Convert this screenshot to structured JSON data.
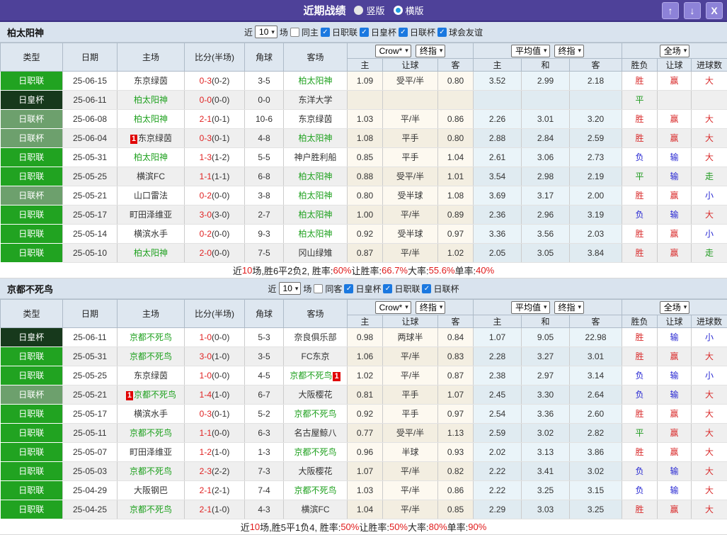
{
  "titlebar": {
    "title": "近期战绩",
    "radios": [
      {
        "label": "竖版",
        "selected": false
      },
      {
        "label": "横版",
        "selected": true
      }
    ],
    "buttons": {
      "up": "↑",
      "down": "↓",
      "close": "X"
    }
  },
  "table_header": {
    "main": [
      "类型",
      "日期",
      "主场",
      "比分(半场)",
      "角球",
      "客场"
    ],
    "sub": [
      "主",
      "让球",
      "客",
      "主",
      "和",
      "客",
      "胜负",
      "让球",
      "进球数"
    ],
    "selects": {
      "bookmaker": "Crow*",
      "bookmaker_final": "终指",
      "average": "平均值",
      "average_final": "终指",
      "scope": "全场"
    }
  },
  "sections": [
    {
      "team": "柏太阳神",
      "filter": {
        "prefix": "近",
        "count": "10",
        "suffix": "场",
        "same_label": "同主",
        "same_checked": false,
        "leagues": [
          "日职联",
          "日皇杯",
          "日联杯",
          "球会友谊"
        ]
      },
      "rows": [
        {
          "league": "日职联",
          "league_cls": "j1",
          "date": "25-06-15",
          "home": {
            "name": "东京绿茵",
            "focal": false,
            "badge": null
          },
          "score": "0-3",
          "half": "(0-2)",
          "corners": "3-5",
          "away": {
            "name": "柏太阳神",
            "focal": true,
            "badge": null
          },
          "crow_home": "1.09",
          "handicap": "受平/半",
          "crow_away": "0.80",
          "avg_home": "3.52",
          "avg_draw": "2.99",
          "avg_away": "2.18",
          "result": {
            "text": "胜",
            "cls": "win"
          },
          "handicap_result": {
            "text": "赢",
            "cls": "win"
          },
          "goals": {
            "text": "大",
            "cls": "win"
          }
        },
        {
          "league": "日皇杯",
          "league_cls": "cup",
          "date": "25-06-11",
          "home": {
            "name": "柏太阳神",
            "focal": true,
            "badge": null
          },
          "score": "0-0",
          "half": "(0-0)",
          "corners": "0-0",
          "away": {
            "name": "东洋大学",
            "focal": false,
            "badge": null
          },
          "crow_home": "",
          "handicap": "",
          "crow_away": "",
          "avg_home": "",
          "avg_draw": "",
          "avg_away": "",
          "result": {
            "text": "平",
            "cls": "draw"
          },
          "handicap_result": {
            "text": "",
            "cls": ""
          },
          "goals": {
            "text": "",
            "cls": ""
          }
        },
        {
          "league": "日联杯",
          "league_cls": "lcup",
          "date": "25-06-08",
          "home": {
            "name": "柏太阳神",
            "focal": true,
            "badge": null
          },
          "score": "2-1",
          "half": "(0-1)",
          "corners": "10-6",
          "away": {
            "name": "东京绿茵",
            "focal": false,
            "badge": null
          },
          "crow_home": "1.03",
          "handicap": "平/半",
          "crow_away": "0.86",
          "avg_home": "2.26",
          "avg_draw": "3.01",
          "avg_away": "3.20",
          "result": {
            "text": "胜",
            "cls": "win"
          },
          "handicap_result": {
            "text": "赢",
            "cls": "win"
          },
          "goals": {
            "text": "大",
            "cls": "win"
          }
        },
        {
          "league": "日联杯",
          "league_cls": "lcup",
          "date": "25-06-04",
          "home": {
            "name": "东京绿茵",
            "focal": false,
            "badge": {
              "text": "1",
              "pos": "before"
            }
          },
          "score": "0-3",
          "half": "(0-1)",
          "corners": "4-8",
          "away": {
            "name": "柏太阳神",
            "focal": true,
            "badge": null
          },
          "crow_home": "1.08",
          "handicap": "平手",
          "crow_away": "0.80",
          "avg_home": "2.88",
          "avg_draw": "2.84",
          "avg_away": "2.59",
          "result": {
            "text": "胜",
            "cls": "win"
          },
          "handicap_result": {
            "text": "赢",
            "cls": "win"
          },
          "goals": {
            "text": "大",
            "cls": "win"
          }
        },
        {
          "league": "日职联",
          "league_cls": "j1",
          "date": "25-05-31",
          "home": {
            "name": "柏太阳神",
            "focal": true,
            "badge": null
          },
          "score": "1-3",
          "half": "(1-2)",
          "corners": "5-5",
          "away": {
            "name": "神户胜利船",
            "focal": false,
            "badge": null
          },
          "crow_home": "0.85",
          "handicap": "平手",
          "crow_away": "1.04",
          "avg_home": "2.61",
          "avg_draw": "3.06",
          "avg_away": "2.73",
          "result": {
            "text": "负",
            "cls": "lose"
          },
          "handicap_result": {
            "text": "输",
            "cls": "lose"
          },
          "goals": {
            "text": "大",
            "cls": "win"
          }
        },
        {
          "league": "日职联",
          "league_cls": "j1",
          "date": "25-05-25",
          "home": {
            "name": "横滨FC",
            "focal": false,
            "badge": null
          },
          "score": "1-1",
          "half": "(1-1)",
          "corners": "6-8",
          "away": {
            "name": "柏太阳神",
            "focal": true,
            "badge": null
          },
          "crow_home": "0.88",
          "handicap": "受平/半",
          "crow_away": "1.01",
          "avg_home": "3.54",
          "avg_draw": "2.98",
          "avg_away": "2.19",
          "result": {
            "text": "平",
            "cls": "draw"
          },
          "handicap_result": {
            "text": "输",
            "cls": "lose"
          },
          "goals": {
            "text": "走",
            "cls": "draw"
          }
        },
        {
          "league": "日联杯",
          "league_cls": "lcup",
          "date": "25-05-21",
          "home": {
            "name": "山口雷法",
            "focal": false,
            "badge": null
          },
          "score": "0-2",
          "half": "(0-0)",
          "corners": "3-8",
          "away": {
            "name": "柏太阳神",
            "focal": true,
            "badge": null
          },
          "crow_home": "0.80",
          "handicap": "受半球",
          "crow_away": "1.08",
          "avg_home": "3.69",
          "avg_draw": "3.17",
          "avg_away": "2.00",
          "result": {
            "text": "胜",
            "cls": "win"
          },
          "handicap_result": {
            "text": "赢",
            "cls": "win"
          },
          "goals": {
            "text": "小",
            "cls": "lose"
          }
        },
        {
          "league": "日职联",
          "league_cls": "j1",
          "date": "25-05-17",
          "home": {
            "name": "町田泽维亚",
            "focal": false,
            "badge": null
          },
          "score": "3-0",
          "half": "(3-0)",
          "corners": "2-7",
          "away": {
            "name": "柏太阳神",
            "focal": true,
            "badge": null
          },
          "crow_home": "1.00",
          "handicap": "平/半",
          "crow_away": "0.89",
          "avg_home": "2.36",
          "avg_draw": "2.96",
          "avg_away": "3.19",
          "result": {
            "text": "负",
            "cls": "lose"
          },
          "handicap_result": {
            "text": "输",
            "cls": "lose"
          },
          "goals": {
            "text": "大",
            "cls": "win"
          }
        },
        {
          "league": "日职联",
          "league_cls": "j1",
          "date": "25-05-14",
          "home": {
            "name": "横滨水手",
            "focal": false,
            "badge": null
          },
          "score": "0-2",
          "half": "(0-0)",
          "corners": "9-3",
          "away": {
            "name": "柏太阳神",
            "focal": true,
            "badge": null
          },
          "crow_home": "0.92",
          "handicap": "受半球",
          "crow_away": "0.97",
          "avg_home": "3.36",
          "avg_draw": "3.56",
          "avg_away": "2.03",
          "result": {
            "text": "胜",
            "cls": "win"
          },
          "handicap_result": {
            "text": "赢",
            "cls": "win"
          },
          "goals": {
            "text": "小",
            "cls": "lose"
          }
        },
        {
          "league": "日职联",
          "league_cls": "j1",
          "date": "25-05-10",
          "home": {
            "name": "柏太阳神",
            "focal": true,
            "badge": null
          },
          "score": "2-0",
          "half": "(0-0)",
          "corners": "7-5",
          "away": {
            "name": "冈山绿雉",
            "focal": false,
            "badge": null
          },
          "crow_home": "0.87",
          "handicap": "平/半",
          "crow_away": "1.02",
          "avg_home": "2.05",
          "avg_draw": "3.05",
          "avg_away": "3.84",
          "result": {
            "text": "胜",
            "cls": "win"
          },
          "handicap_result": {
            "text": "赢",
            "cls": "win"
          },
          "goals": {
            "text": "走",
            "cls": "draw"
          }
        }
      ],
      "summary": [
        {
          "text": "近"
        },
        {
          "text": "10",
          "red": true
        },
        {
          "text": "场,胜6平2负2, 胜率:"
        },
        {
          "text": "60%",
          "red": true
        },
        {
          "text": " 让胜率:"
        },
        {
          "text": "66.7%",
          "red": true
        },
        {
          "text": " 大率:"
        },
        {
          "text": "55.6%",
          "red": true
        },
        {
          "text": " 单率:"
        },
        {
          "text": "40%",
          "red": true
        }
      ]
    },
    {
      "team": "京都不死鸟",
      "filter": {
        "prefix": "近",
        "count": "10",
        "suffix": "场",
        "same_label": "同客",
        "same_checked": false,
        "leagues": [
          "日皇杯",
          "日职联",
          "日联杯"
        ]
      },
      "rows": [
        {
          "league": "日皇杯",
          "league_cls": "cup",
          "date": "25-06-11",
          "home": {
            "name": "京都不死鸟",
            "focal": true,
            "badge": null
          },
          "score": "1-0",
          "half": "(0-0)",
          "corners": "5-3",
          "away": {
            "name": "奈良俱乐部",
            "focal": false,
            "badge": null
          },
          "crow_home": "0.98",
          "handicap": "两球半",
          "crow_away": "0.84",
          "avg_home": "1.07",
          "avg_draw": "9.05",
          "avg_away": "22.98",
          "result": {
            "text": "胜",
            "cls": "win"
          },
          "handicap_result": {
            "text": "输",
            "cls": "lose"
          },
          "goals": {
            "text": "小",
            "cls": "lose"
          }
        },
        {
          "league": "日职联",
          "league_cls": "j1",
          "date": "25-05-31",
          "home": {
            "name": "京都不死鸟",
            "focal": true,
            "badge": null
          },
          "score": "3-0",
          "half": "(1-0)",
          "corners": "3-5",
          "away": {
            "name": "FC东京",
            "focal": false,
            "badge": null
          },
          "crow_home": "1.06",
          "handicap": "平/半",
          "crow_away": "0.83",
          "avg_home": "2.28",
          "avg_draw": "3.27",
          "avg_away": "3.01",
          "result": {
            "text": "胜",
            "cls": "win"
          },
          "handicap_result": {
            "text": "赢",
            "cls": "win"
          },
          "goals": {
            "text": "大",
            "cls": "win"
          }
        },
        {
          "league": "日职联",
          "league_cls": "j1",
          "date": "25-05-25",
          "home": {
            "name": "东京绿茵",
            "focal": false,
            "badge": null
          },
          "score": "1-0",
          "half": "(0-0)",
          "corners": "4-5",
          "away": {
            "name": "京都不死鸟",
            "focal": true,
            "badge": {
              "text": "1",
              "pos": "after"
            }
          },
          "crow_home": "1.02",
          "handicap": "平/半",
          "crow_away": "0.87",
          "avg_home": "2.38",
          "avg_draw": "2.97",
          "avg_away": "3.14",
          "result": {
            "text": "负",
            "cls": "lose"
          },
          "handicap_result": {
            "text": "输",
            "cls": "lose"
          },
          "goals": {
            "text": "小",
            "cls": "lose"
          }
        },
        {
          "league": "日联杯",
          "league_cls": "lcup",
          "date": "25-05-21",
          "home": {
            "name": "京都不死鸟",
            "focal": true,
            "badge": {
              "text": "1",
              "pos": "before"
            }
          },
          "score": "1-4",
          "half": "(1-0)",
          "corners": "6-7",
          "away": {
            "name": "大阪樱花",
            "focal": false,
            "badge": null
          },
          "crow_home": "0.81",
          "handicap": "平手",
          "crow_away": "1.07",
          "avg_home": "2.45",
          "avg_draw": "3.30",
          "avg_away": "2.64",
          "result": {
            "text": "负",
            "cls": "lose"
          },
          "handicap_result": {
            "text": "输",
            "cls": "lose"
          },
          "goals": {
            "text": "大",
            "cls": "win"
          }
        },
        {
          "league": "日职联",
          "league_cls": "j1",
          "date": "25-05-17",
          "home": {
            "name": "横滨水手",
            "focal": false,
            "badge": null
          },
          "score": "0-3",
          "half": "(0-1)",
          "corners": "5-2",
          "away": {
            "name": "京都不死鸟",
            "focal": true,
            "badge": null
          },
          "crow_home": "0.92",
          "handicap": "平手",
          "crow_away": "0.97",
          "avg_home": "2.54",
          "avg_draw": "3.36",
          "avg_away": "2.60",
          "result": {
            "text": "胜",
            "cls": "win"
          },
          "handicap_result": {
            "text": "赢",
            "cls": "win"
          },
          "goals": {
            "text": "大",
            "cls": "win"
          }
        },
        {
          "league": "日职联",
          "league_cls": "j1",
          "date": "25-05-11",
          "home": {
            "name": "京都不死鸟",
            "focal": true,
            "badge": null
          },
          "score": "1-1",
          "half": "(0-0)",
          "corners": "6-3",
          "away": {
            "name": "名古屋鲸八",
            "focal": false,
            "badge": null
          },
          "crow_home": "0.77",
          "handicap": "受平/半",
          "crow_away": "1.13",
          "avg_home": "2.59",
          "avg_draw": "3.02",
          "avg_away": "2.82",
          "result": {
            "text": "平",
            "cls": "draw"
          },
          "handicap_result": {
            "text": "赢",
            "cls": "win"
          },
          "goals": {
            "text": "大",
            "cls": "win"
          }
        },
        {
          "league": "日职联",
          "league_cls": "j1",
          "date": "25-05-07",
          "home": {
            "name": "町田泽维亚",
            "focal": false,
            "badge": null
          },
          "score": "1-2",
          "half": "(1-0)",
          "corners": "1-3",
          "away": {
            "name": "京都不死鸟",
            "focal": true,
            "badge": null
          },
          "crow_home": "0.96",
          "handicap": "半球",
          "crow_away": "0.93",
          "avg_home": "2.02",
          "avg_draw": "3.13",
          "avg_away": "3.86",
          "result": {
            "text": "胜",
            "cls": "win"
          },
          "handicap_result": {
            "text": "赢",
            "cls": "win"
          },
          "goals": {
            "text": "大",
            "cls": "win"
          }
        },
        {
          "league": "日职联",
          "league_cls": "j1",
          "date": "25-05-03",
          "home": {
            "name": "京都不死鸟",
            "focal": true,
            "badge": null
          },
          "score": "2-3",
          "half": "(2-2)",
          "corners": "7-3",
          "away": {
            "name": "大阪樱花",
            "focal": false,
            "badge": null
          },
          "crow_home": "1.07",
          "handicap": "平/半",
          "crow_away": "0.82",
          "avg_home": "2.22",
          "avg_draw": "3.41",
          "avg_away": "3.02",
          "result": {
            "text": "负",
            "cls": "lose"
          },
          "handicap_result": {
            "text": "输",
            "cls": "lose"
          },
          "goals": {
            "text": "大",
            "cls": "win"
          }
        },
        {
          "league": "日职联",
          "league_cls": "j1",
          "date": "25-04-29",
          "home": {
            "name": "大阪钢巴",
            "focal": false,
            "badge": null
          },
          "score": "2-1",
          "half": "(2-1)",
          "corners": "7-4",
          "away": {
            "name": "京都不死鸟",
            "focal": true,
            "badge": null
          },
          "crow_home": "1.03",
          "handicap": "平/半",
          "crow_away": "0.86",
          "avg_home": "2.22",
          "avg_draw": "3.25",
          "avg_away": "3.15",
          "result": {
            "text": "负",
            "cls": "lose"
          },
          "handicap_result": {
            "text": "输",
            "cls": "lose"
          },
          "goals": {
            "text": "大",
            "cls": "win"
          }
        },
        {
          "league": "日职联",
          "league_cls": "j1",
          "date": "25-04-25",
          "home": {
            "name": "京都不死鸟",
            "focal": true,
            "badge": null
          },
          "score": "2-1",
          "half": "(1-0)",
          "corners": "4-3",
          "away": {
            "name": "横滨FC",
            "focal": false,
            "badge": null
          },
          "crow_home": "1.04",
          "handicap": "平/半",
          "crow_away": "0.85",
          "avg_home": "2.29",
          "avg_draw": "3.03",
          "avg_away": "3.25",
          "result": {
            "text": "胜",
            "cls": "win"
          },
          "handicap_result": {
            "text": "赢",
            "cls": "win"
          },
          "goals": {
            "text": "大",
            "cls": "win"
          }
        }
      ],
      "summary": [
        {
          "text": "近"
        },
        {
          "text": "10",
          "red": true
        },
        {
          "text": "场,胜5平1负4, 胜率:"
        },
        {
          "text": "50%",
          "red": true
        },
        {
          "text": " 让胜率:"
        },
        {
          "text": "50%",
          "red": true
        },
        {
          "text": " 大率:"
        },
        {
          "text": "80%",
          "red": true
        },
        {
          "text": " 单率:"
        },
        {
          "text": "90%",
          "red": true
        }
      ]
    }
  ]
}
